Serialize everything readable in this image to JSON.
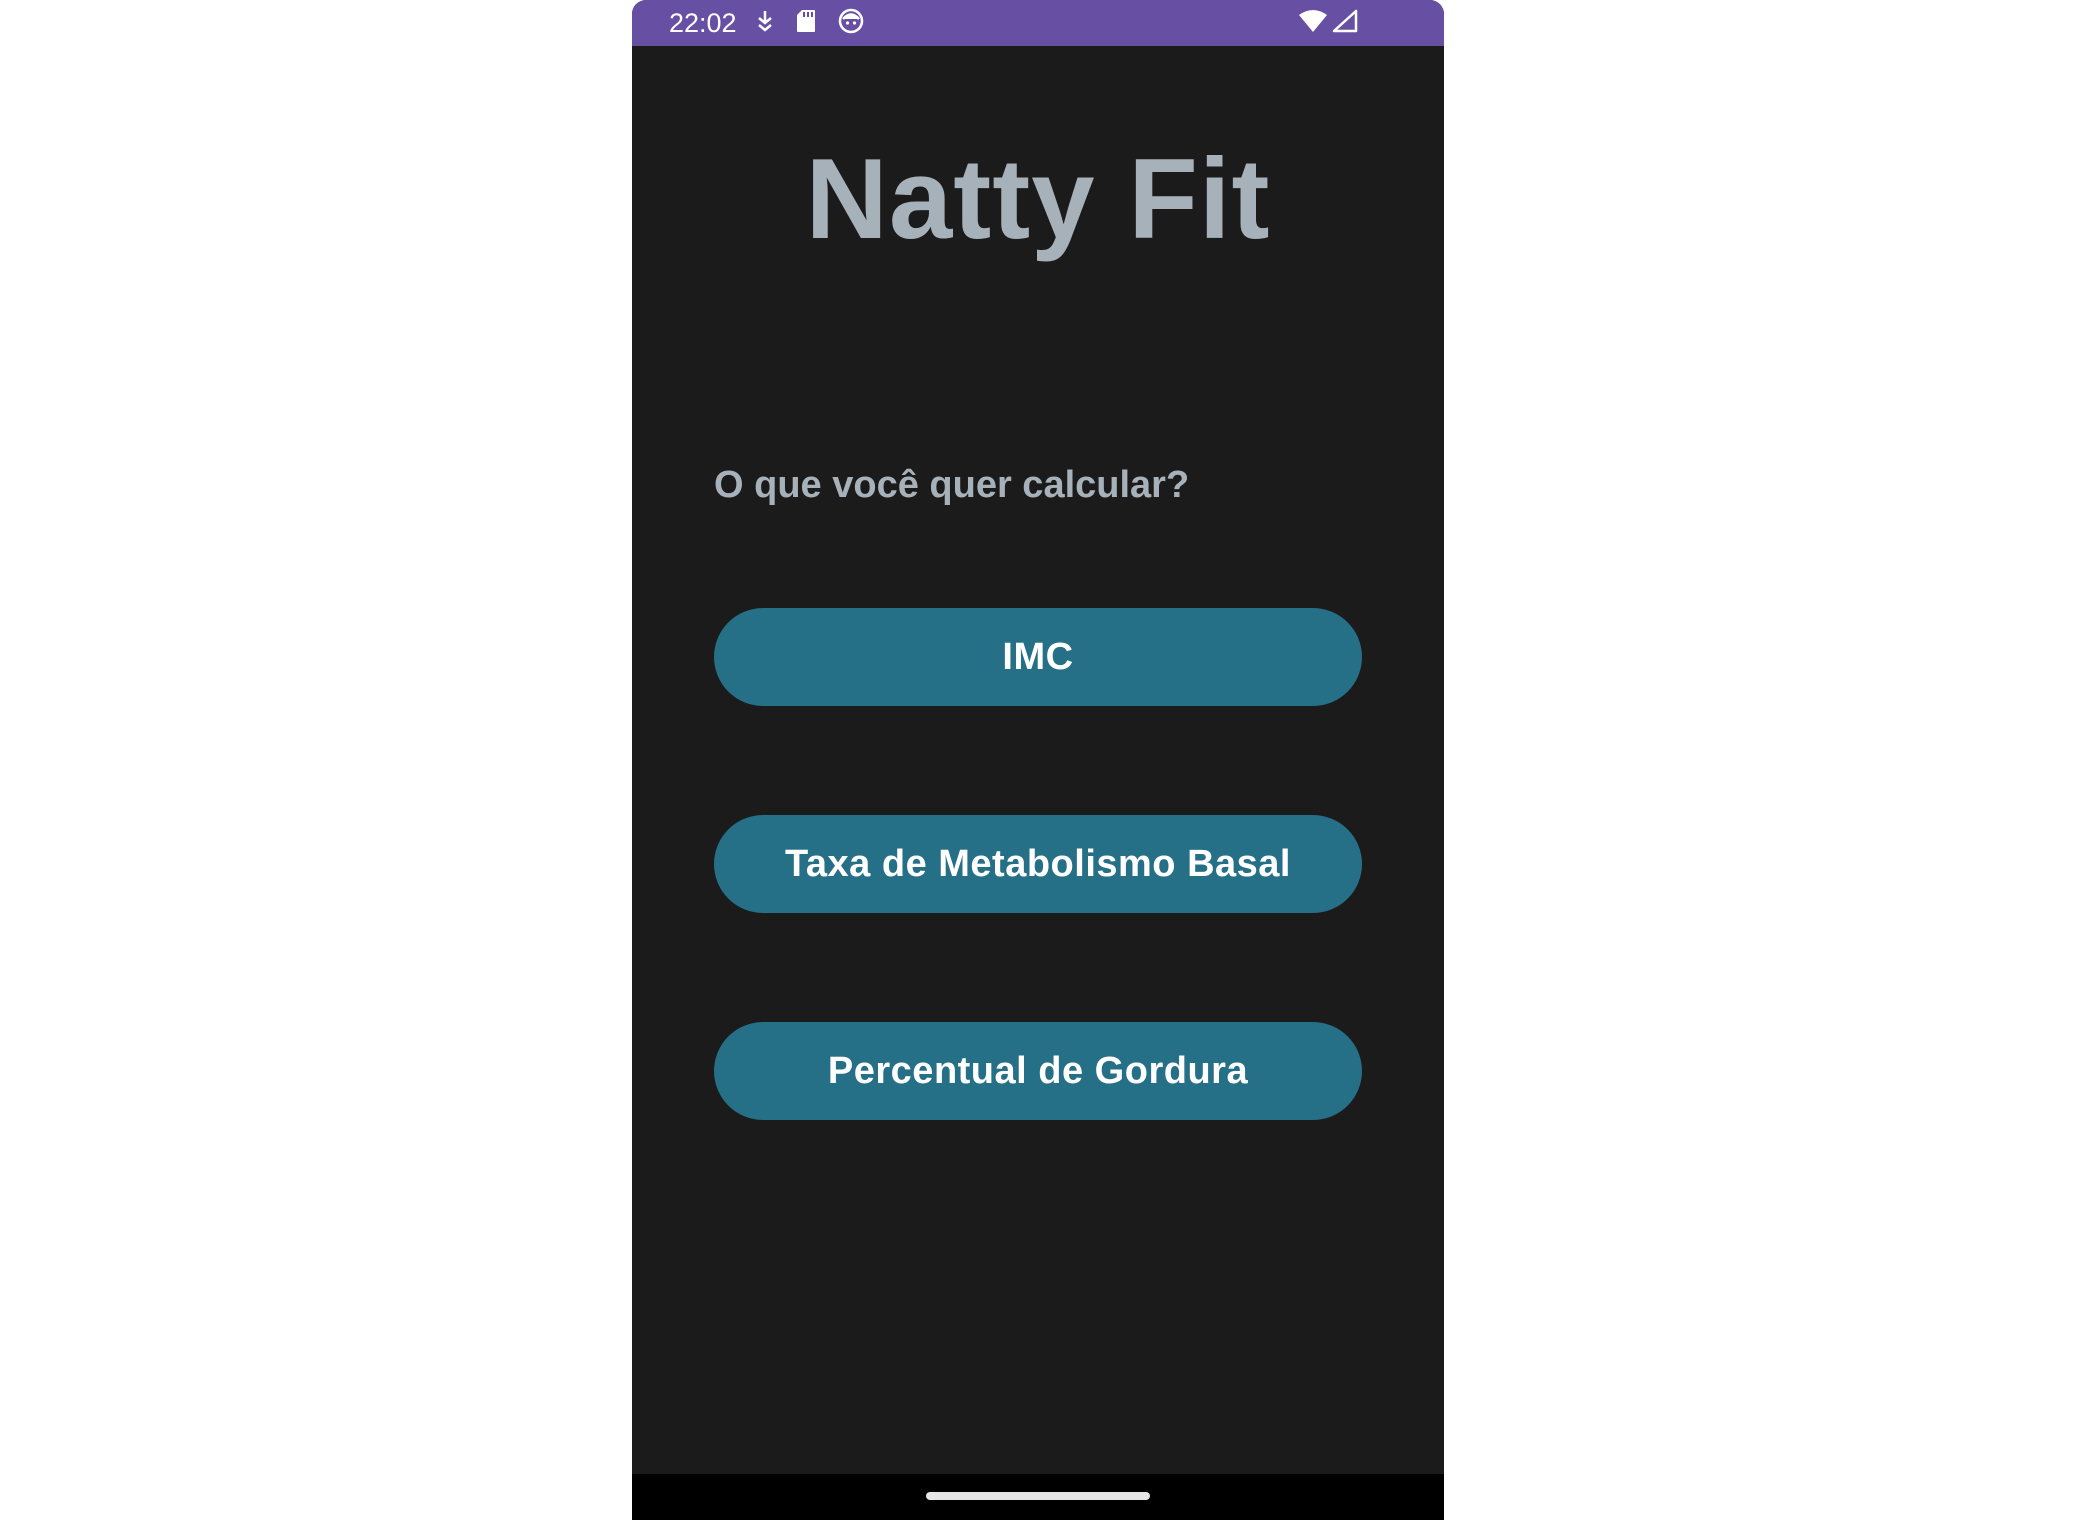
{
  "status_bar": {
    "time": "22:02",
    "left_icons": [
      "download-icon",
      "sd-card-icon",
      "face-notification-icon"
    ],
    "right_icons": [
      "wifi-icon",
      "signal-icon"
    ],
    "color": "#6750a4"
  },
  "app": {
    "title": "Natty Fit",
    "question": "O que você quer calcular?",
    "buttons": {
      "imc": "IMC",
      "tmb": "Taxa de Metabolismo Basal",
      "gordura": "Percentual de Gordura"
    }
  },
  "colors": {
    "background": "#1b1b1b",
    "title_text": "#a6b1ba",
    "button": "#267087",
    "button_text": "#ffffff"
  }
}
